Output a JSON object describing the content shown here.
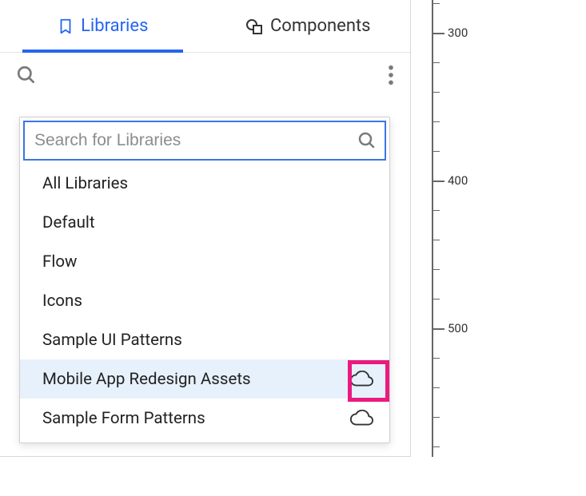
{
  "tabs": {
    "libraries": "Libraries",
    "components": "Components"
  },
  "search": {
    "placeholder": "Search for Libraries"
  },
  "items": [
    {
      "label": "All Libraries",
      "cloud": false,
      "selected": false
    },
    {
      "label": "Default",
      "cloud": false,
      "selected": false
    },
    {
      "label": "Flow",
      "cloud": false,
      "selected": false
    },
    {
      "label": "Icons",
      "cloud": false,
      "selected": false
    },
    {
      "label": "Sample UI Patterns",
      "cloud": false,
      "selected": false
    },
    {
      "label": "Mobile App Redesign Assets",
      "cloud": true,
      "selected": true
    },
    {
      "label": "Sample Form Patterns",
      "cloud": true,
      "selected": false
    }
  ],
  "ruler": {
    "labels": [
      "300",
      "400",
      "500"
    ]
  }
}
